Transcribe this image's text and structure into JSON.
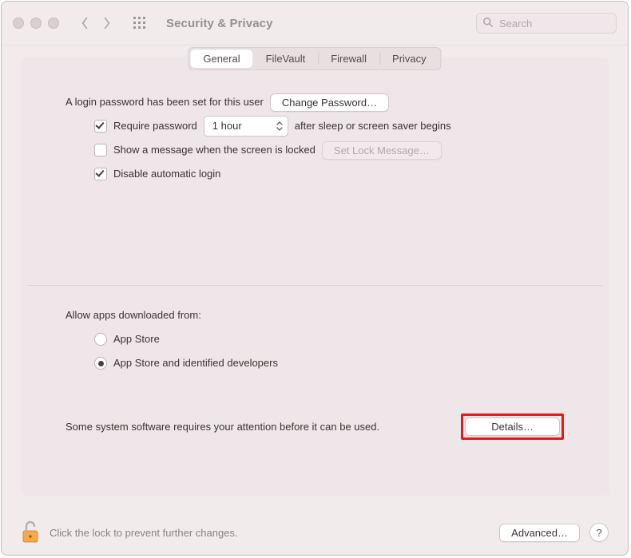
{
  "toolbar": {
    "title": "Security & Privacy",
    "search_placeholder": "Search"
  },
  "tabs": {
    "items": [
      "General",
      "FileVault",
      "Firewall",
      "Privacy"
    ],
    "active_index": 0
  },
  "general": {
    "login_text": "A login password has been set for this user",
    "change_password_label": "Change Password…",
    "require_checked": true,
    "require_label": "Require password",
    "require_delay": "1 hour",
    "require_after": "after sleep or screen saver begins",
    "show_message_checked": false,
    "show_message_label": "Show a message when the screen is locked",
    "set_lock_message_label": "Set Lock Message…",
    "disable_auto_checked": true,
    "disable_auto_label": "Disable automatic login"
  },
  "download": {
    "heading": "Allow apps downloaded from:",
    "option_appstore": "App Store",
    "option_identified": "App Store and identified developers",
    "selected": "identified",
    "attention_text": "Some system software requires your attention before it can be used.",
    "details_label": "Details…"
  },
  "footer": {
    "lock_text": "Click the lock to prevent further changes.",
    "advanced_label": "Advanced…",
    "help_label": "?"
  }
}
